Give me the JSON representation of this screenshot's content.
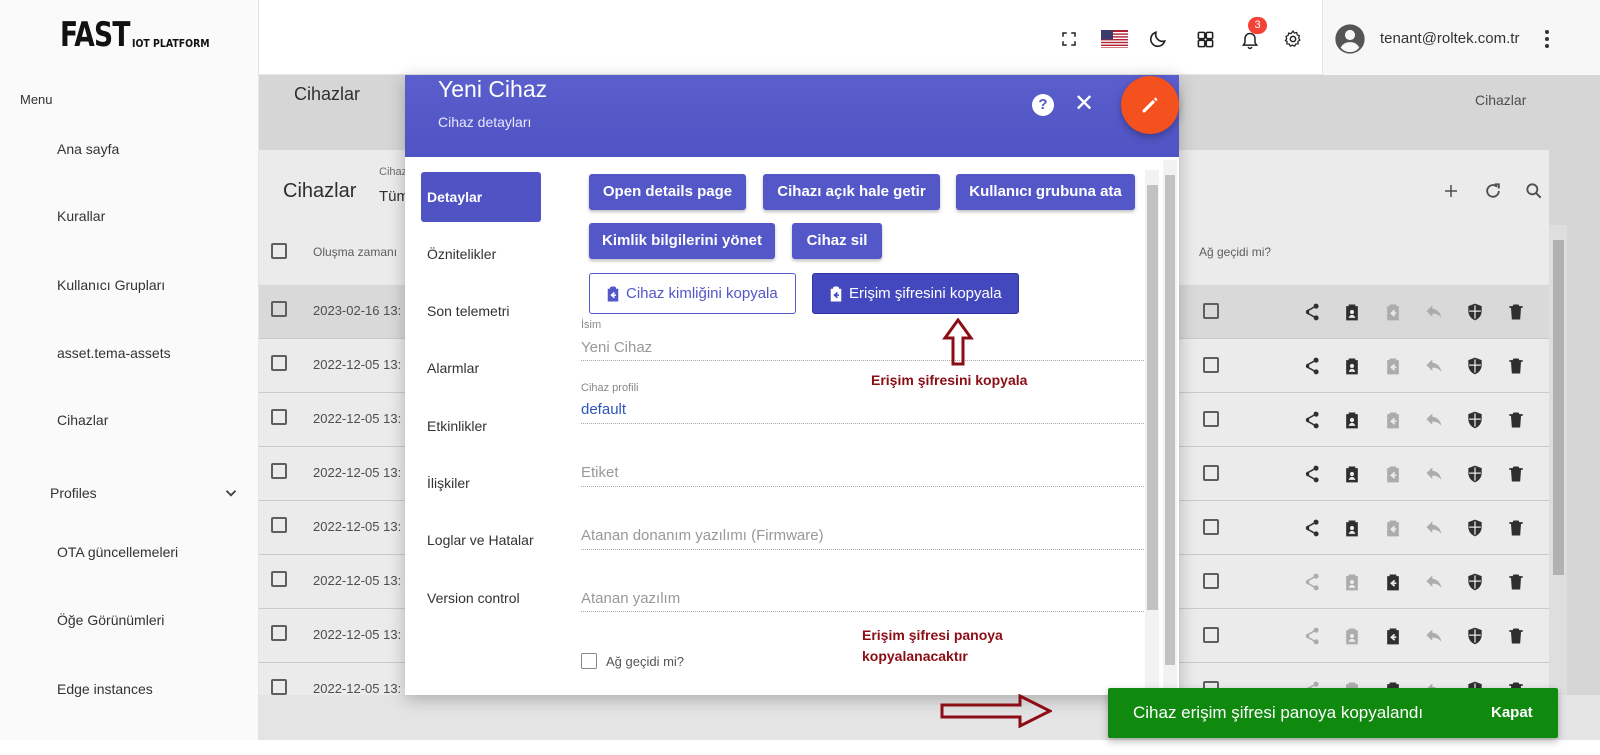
{
  "logo": {
    "big": "FAST",
    "small": "IOT PLATFORM"
  },
  "sidebar": {
    "menu_label": "Menu",
    "items": [
      {
        "label": "Ana sayfa"
      },
      {
        "label": "Kurallar"
      },
      {
        "label": "Kullanıcı Grupları"
      },
      {
        "label": "asset.tema-assets"
      },
      {
        "label": "Cihazlar"
      },
      {
        "label": "Profiles"
      },
      {
        "label": "OTA güncellemeleri"
      },
      {
        "label": "Öğe Görünümleri"
      },
      {
        "label": "Edge instances"
      }
    ]
  },
  "topbar": {
    "notification_count": "3",
    "user_email": "tenant@roltek.com.tr",
    "icons": [
      "fullscreen-icon",
      "us-flag-icon",
      "moon-icon",
      "apps-grid-icon",
      "bell-icon",
      "gear-icon",
      "account-circle-icon",
      "more-vert-icon"
    ]
  },
  "background": {
    "page_title": "Cihazlar",
    "breadcrumb_right": "Cihazlar",
    "table_title": "Cihazlar",
    "filter_label": "Cihaz",
    "filter_value": "Tüm",
    "columns": {
      "created": "Oluşma zamanı",
      "gateway": "Ağ geçidi mi?"
    },
    "rows": [
      {
        "date": "2023-02-16 13:"
      },
      {
        "date": "2022-12-05 13:"
      },
      {
        "date": "2022-12-05 13:"
      },
      {
        "date": "2022-12-05 13:"
      },
      {
        "date": "2022-12-05 13:"
      },
      {
        "date": "2022-12-05 13:"
      },
      {
        "date": "2022-12-05 13:"
      },
      {
        "date": "2022-12-05 13:"
      }
    ]
  },
  "dialog": {
    "title": "Yeni Cihaz",
    "subtitle": "Cihaz detayları",
    "help_label": "?",
    "close_label": "✕",
    "tabs": [
      {
        "label": "Detaylar",
        "active": true
      },
      {
        "label": "Öznitelikler"
      },
      {
        "label": "Son telemetri"
      },
      {
        "label": "Alarmlar"
      },
      {
        "label": "Etkinlikler"
      },
      {
        "label": "İlişkiler"
      },
      {
        "label": "Loglar ve Hatalar"
      },
      {
        "label": "Version control"
      }
    ],
    "buttons": {
      "open_details": "Open details page",
      "make_public": "Cihazı açık hale getir",
      "assign_group": "Kullanıcı grubuna ata",
      "manage_credentials": "Kimlik bilgilerini yönet",
      "delete_device": "Cihaz sil",
      "copy_device_id": "Cihaz kimliğini kopyala",
      "copy_access_token": "Erişim şifresini kopyala"
    },
    "fields": {
      "name_label": "İsim",
      "name_value": "Yeni Cihaz",
      "profile_label": "Cihaz profili",
      "profile_value": "default",
      "label_placeholder": "Etiket",
      "firmware_placeholder": "Atanan donanım yazılımı (Firmware)",
      "software_placeholder": "Atanan yazılım",
      "gateway_label": "Ağ geçidi mi?"
    }
  },
  "annotations": {
    "arrow_note": "Erişim şifresini kopyala",
    "clipboard_note_line1": "Erişim şifresi panoya",
    "clipboard_note_line2": "kopyalanacaktır"
  },
  "snackbar": {
    "message": "Cihaz erişim şifresi panoya kopyalandı",
    "close_label": "Kapat",
    "color": "#0f8a0f"
  },
  "colors": {
    "accent": "#5357c8",
    "fab": "#f4511e",
    "annotation": "#8b0d16"
  }
}
